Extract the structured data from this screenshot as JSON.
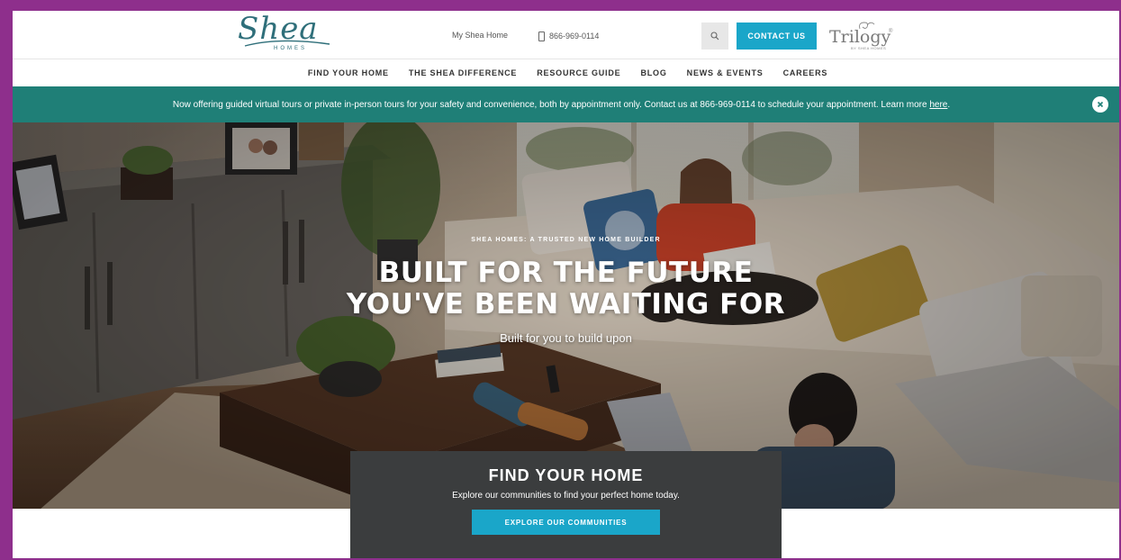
{
  "header": {
    "logo_text": "Shea",
    "logo_sub": "HOMES",
    "my_shea_link": "My Shea Home",
    "phone": "866-969-0114",
    "contact_button": "CONTACT US",
    "trilogy_text": "Trilogy",
    "trilogy_mark": "®",
    "trilogy_sub": "BY SHEA HOMES",
    "search_icon": "search-icon"
  },
  "nav": {
    "items": [
      {
        "label": "FIND YOUR HOME"
      },
      {
        "label": "THE SHEA DIFFERENCE"
      },
      {
        "label": "RESOURCE GUIDE"
      },
      {
        "label": "BLOG"
      },
      {
        "label": "NEWS & EVENTS"
      },
      {
        "label": "CAREERS"
      }
    ]
  },
  "banner": {
    "text": "Now offering guided virtual tours or private in-person tours for your safety and convenience, both by appointment only. Contact us at 866-969-0114 to schedule your appointment. Learn more",
    "link": "here",
    "suffix": ".",
    "close_icon": "close-icon"
  },
  "hero": {
    "eyebrow": "SHEA HOMES: A TRUSTED NEW HOME BUILDER",
    "headline_line1": "BUILT FOR THE FUTURE",
    "headline_line2": "YOU'VE BEEN WAITING FOR",
    "subhead": "Built for you to build upon"
  },
  "find_home": {
    "title": "FIND YOUR HOME",
    "description": "Explore our communities to find your perfect home today.",
    "button": "EXPLORE OUR COMMUNITIES"
  },
  "colors": {
    "frame": "#8e2f8c",
    "accent": "#1aa6c9",
    "banner": "#1f7f77",
    "card": "#3b3d3e",
    "logo": "#2f6f7a"
  }
}
